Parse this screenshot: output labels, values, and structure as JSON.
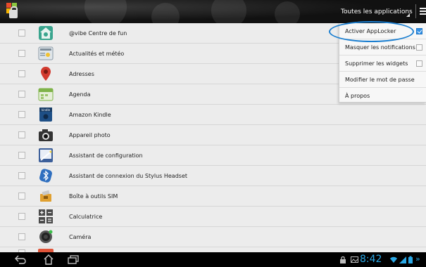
{
  "header": {
    "spinner_label": "Toutes les applications"
  },
  "apps": [
    {
      "label": "@vibe Centre de fun",
      "icon": "vibe-app-icon",
      "color": "#3aa58e"
    },
    {
      "label": "Actualités et météo",
      "icon": "news-weather-app-icon",
      "color": "#a9b7c2"
    },
    {
      "label": "Adresses",
      "icon": "map-pin-icon",
      "color": "#d23a2e"
    },
    {
      "label": "Agenda",
      "icon": "calendar-app-icon",
      "color": "#7fb34a"
    },
    {
      "label": "Amazon Kindle",
      "icon": "kindle-app-icon",
      "color": "#1e4f86"
    },
    {
      "label": "Appareil photo",
      "icon": "camera-app-icon",
      "color": "#333333"
    },
    {
      "label": "Assistant de configuration",
      "icon": "setup-wizard-icon",
      "color": "#3c5f9a"
    },
    {
      "label": "Assistant de connexion du Stylus Headset",
      "icon": "bluetooth-app-icon",
      "color": "#2f6fbf"
    },
    {
      "label": "Boîte à outils SIM",
      "icon": "sim-toolkit-icon",
      "color": "#e0a030"
    },
    {
      "label": "Calculatrice",
      "icon": "calculator-app-icon",
      "color": "#4a4a4a"
    },
    {
      "label": "Caméra",
      "icon": "camera-lens-icon",
      "color": "#555555"
    }
  ],
  "menu": {
    "items": [
      {
        "label": "Activer AppLocker",
        "checkbox": true,
        "checked": true
      },
      {
        "label": "Masquer les notifications",
        "checkbox": true,
        "checked": false
      },
      {
        "label": "Supprimer les widgets",
        "checkbox": true,
        "checked": false
      },
      {
        "label": "Modifier le mot de passe",
        "checkbox": false,
        "checked": false
      },
      {
        "label": "À propos",
        "checkbox": false,
        "checked": false
      }
    ]
  },
  "statusbar": {
    "clock": "8:42"
  },
  "colors": {
    "accent": "#1a7ed0",
    "clock": "#2aa8e6"
  }
}
